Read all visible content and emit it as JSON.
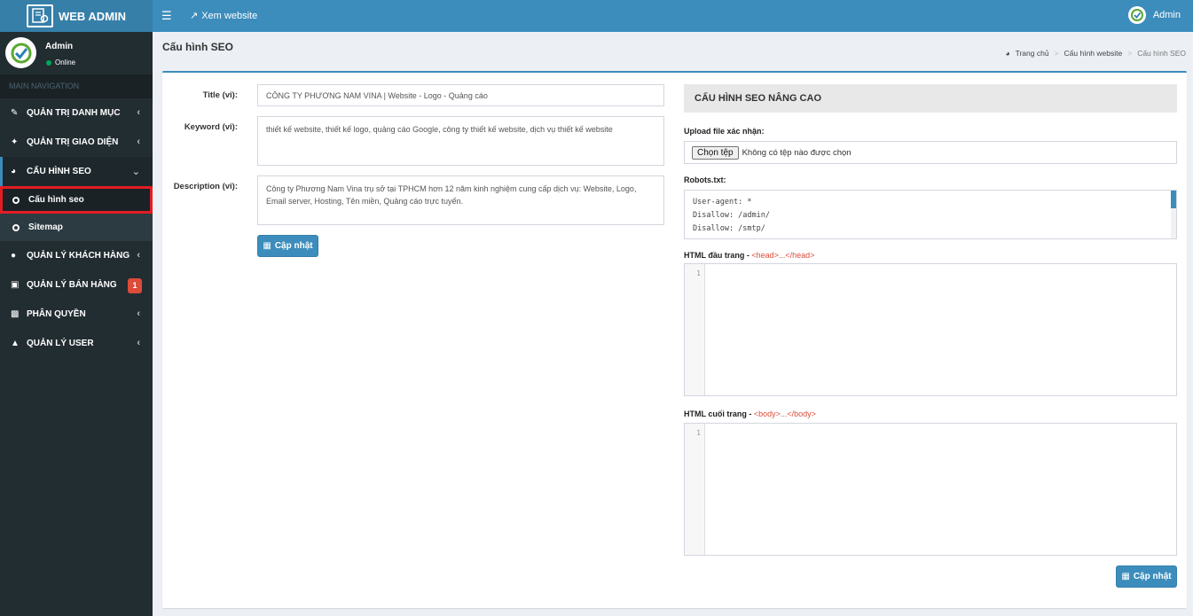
{
  "header": {
    "logo_text": "WEB ADMIN",
    "view_site": "Xem website",
    "user": "Admin"
  },
  "sidebar": {
    "user_name": "Admin",
    "user_status": "Online",
    "nav_header": "MAIN NAVIGATION",
    "items": [
      {
        "label": "QUẢN TRỊ DANH MỤC",
        "icon": "edit-icon"
      },
      {
        "label": "QUẢN TRỊ GIAO DIỆN",
        "icon": "magic-icon"
      },
      {
        "label": "CẤU HÌNH SEO",
        "icon": "dashboard-icon"
      },
      {
        "label": "QUẢN LÝ KHÁCH HÀNG",
        "icon": "users-icon"
      },
      {
        "label": "QUẢN LÝ BÁN HÀNG",
        "icon": "money-icon",
        "badge": "1"
      },
      {
        "label": "PHÂN QUYỀN",
        "icon": "lock-icon"
      },
      {
        "label": "QUẢN LÝ USER",
        "icon": "user-icon"
      }
    ],
    "sub_items": [
      {
        "label": "Cấu hình seo"
      },
      {
        "label": "Sitemap"
      }
    ]
  },
  "page": {
    "title": "Cấu hình SEO",
    "breadcrumb": [
      "Trang chủ",
      "Cấu hình website",
      "Cấu hình SEO"
    ]
  },
  "form": {
    "title_label": "Title (vi):",
    "title_value": "CÔNG TY PHƯƠNG NAM VINA | Website - Logo - Quảng cáo",
    "keyword_label": "Keyword (vi):",
    "keyword_value": "thiết kế website, thiết kế logo, quảng cáo Google, công ty thiết kế website, dịch vụ thiết kế website",
    "description_label": "Description (vi):",
    "description_value": "Công ty Phương Nam Vina trụ sở tại TPHCM hơn 12 năm kinh nghiệm cung cấp dịch vụ: Website, Logo, Email server, Hosting, Tên miền, Quảng cáo trực tuyến.",
    "update_button": "Cập nhật"
  },
  "advanced": {
    "section_title": "CẤU HÌNH SEO NÂNG CAO",
    "upload_label": "Upload file xác nhận:",
    "choose_file": "Chọn tệp",
    "no_file": "Không có tệp nào được chọn",
    "robots_label": "Robots.txt:",
    "robots_lines": [
      "User-agent: *",
      "Disallow: /admin/",
      "Disallow: /smtp/"
    ],
    "head_label": "HTML đầu trang - ",
    "head_tag": "<head>...</head>",
    "body_label": "HTML cuối trang - ",
    "body_tag": "<body>...</body>",
    "line_number": "1",
    "update_button": "Cập nhật"
  }
}
